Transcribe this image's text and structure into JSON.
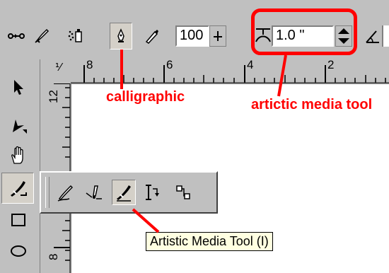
{
  "propbar": {
    "percent_value": "100",
    "nib_size_value": "1.0 \""
  },
  "tools": [
    "pick-icon",
    "shape-icon",
    "pan-hand-icon",
    "artistic-media-icon",
    "rectangle-icon",
    "ellipse-icon"
  ],
  "flyout": {
    "items": [
      "freehand-icon",
      "bezier-icon",
      "artistic-media-icon",
      "dimension-icon",
      "connector-icon"
    ]
  },
  "ruler": {
    "h_labels": [
      "8",
      "6",
      "4",
      "2"
    ],
    "v_labels": [
      "12",
      "8"
    ],
    "units_glyph": "⅟"
  },
  "tooltip": "Artistic Media Tool (I)",
  "annotations": {
    "calligraphic": "calligraphic",
    "artistic_media_tool": "artictic media tool"
  },
  "colors": {
    "chrome": "#c0c0c0",
    "annotation": "#ff0000",
    "tooltip_bg": "#ffffe1"
  }
}
